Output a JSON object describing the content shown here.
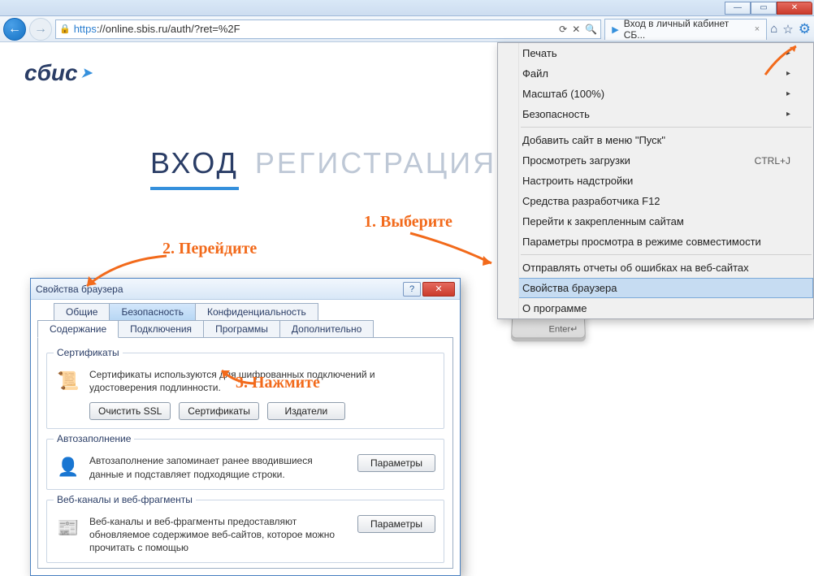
{
  "browser": {
    "url_scheme": "https",
    "url_rest": "://online.sbis.ru/auth/?ret=%2F",
    "tab_title": "Вход в личный кабинет СБ...",
    "nav_back_icon": "←",
    "nav_fwd_icon": "→",
    "refresh_icon": "⟳",
    "search_icon": "🔍",
    "lock_icon": "🔒",
    "home_icon": "⌂",
    "star_icon": "☆",
    "gear_icon": "⚙",
    "tab_close": "×",
    "favicon": "▶"
  },
  "page_content": {
    "logo_text": "сбис",
    "tab_login": "ВХОД",
    "tab_register": "РЕГИСТРАЦИЯ",
    "enter_key_label": "Enter"
  },
  "menu": {
    "items_top": [
      {
        "label": "Печать",
        "submenu": true
      },
      {
        "label": "Файл",
        "submenu": true
      },
      {
        "label": "Масштаб (100%)",
        "submenu": true
      },
      {
        "label": "Безопасность",
        "submenu": true
      }
    ],
    "items_mid": [
      {
        "label": "Добавить сайт в меню \"Пуск\""
      },
      {
        "label": "Просмотреть загрузки",
        "shortcut": "CTRL+J"
      },
      {
        "label": "Настроить надстройки"
      },
      {
        "label": "Средства разработчика F12"
      },
      {
        "label": "Перейти к закрепленным сайтам"
      },
      {
        "label": "Параметры просмотра в режиме совместимости"
      }
    ],
    "items_bot": [
      {
        "label": "Отправлять отчеты об ошибках на веб-сайтах"
      },
      {
        "label": "Свойства браузера",
        "hover": true
      },
      {
        "label": "О программе"
      }
    ]
  },
  "dialog": {
    "title": "Свойства браузера",
    "help_icon": "?",
    "close_icon": "✕",
    "tabs_row1": [
      "Общие",
      "Безопасность",
      "Конфиденциальность"
    ],
    "tabs_row2": [
      "Содержание",
      "Подключения",
      "Программы",
      "Дополнительно"
    ],
    "active_tab_index_row2": 0,
    "cert_group": "Сертификаты",
    "cert_text": "Сертификаты используются для шифрованных подключений и удостоверения подлинности.",
    "cert_icon": "📜",
    "btn_clear_ssl": "Очистить SSL",
    "btn_certs": "Сертификаты",
    "btn_publishers": "Издатели",
    "auto_group": "Автозаполнение",
    "auto_icon": "👤",
    "auto_text": "Автозаполнение запоминает ранее вводившиеся данные и подставляет подходящие строки.",
    "btn_params": "Параметры",
    "feeds_group": "Веб-каналы и веб-фрагменты",
    "feeds_icon": "📰",
    "feeds_text": "Веб-каналы и веб-фрагменты предоставляют обновляемое содержимое веб-сайтов, которое можно прочитать с помощью"
  },
  "annotations": {
    "step1": "1. Выберите",
    "step2": "2. Перейдите",
    "step3": "3. Нажмите"
  }
}
